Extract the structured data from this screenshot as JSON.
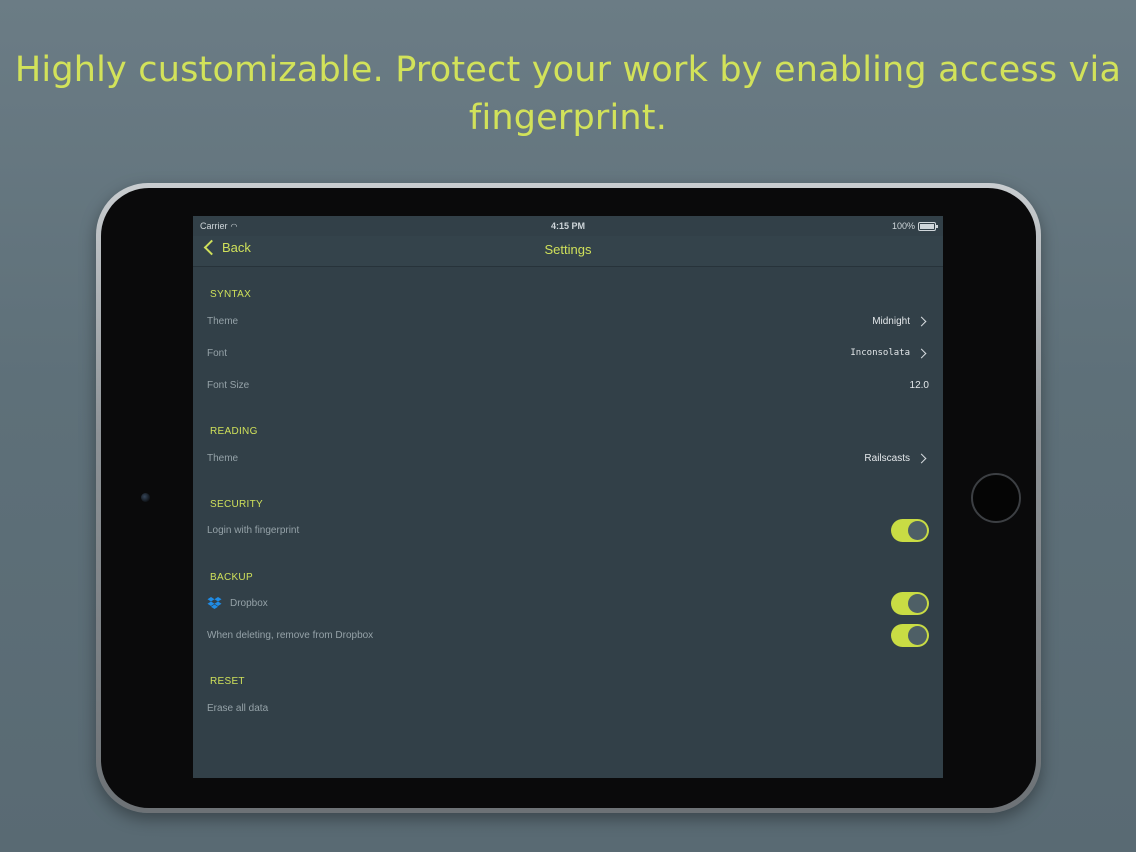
{
  "headline": "Highly customizable. Protect your work by enabling access via fingerprint.",
  "status_bar": {
    "carrier": "Carrier",
    "time": "4:15 PM",
    "battery": "100%"
  },
  "navbar": {
    "back_label": "Back",
    "title": "Settings"
  },
  "sections": {
    "syntax": {
      "header": "SYNTAX",
      "theme_label": "Theme",
      "theme_value": "Midnight",
      "font_label": "Font",
      "font_value": "Inconsolata",
      "font_size_label": "Font Size",
      "font_size_value": "12.0"
    },
    "reading": {
      "header": "READING",
      "theme_label": "Theme",
      "theme_value": "Railscasts"
    },
    "security": {
      "header": "SECURITY",
      "fingerprint_label": "Login with fingerprint",
      "fingerprint_enabled": true
    },
    "backup": {
      "header": "BACKUP",
      "dropbox_label": "Dropbox",
      "dropbox_enabled": true,
      "remove_label": "When deleting, remove from Dropbox",
      "remove_enabled": true
    },
    "reset": {
      "header": "RESET",
      "erase_label": "Erase all data"
    }
  },
  "colors": {
    "accent": "#cfe05a",
    "background": "#5e7079",
    "screen": "#324048",
    "toggle_on": "#c9dc44"
  },
  "icons": {
    "back": "chevron-left-icon",
    "disclosure": "chevron-right-icon",
    "dropbox": "dropbox-icon",
    "wifi": "wifi-icon",
    "battery": "battery-icon"
  }
}
